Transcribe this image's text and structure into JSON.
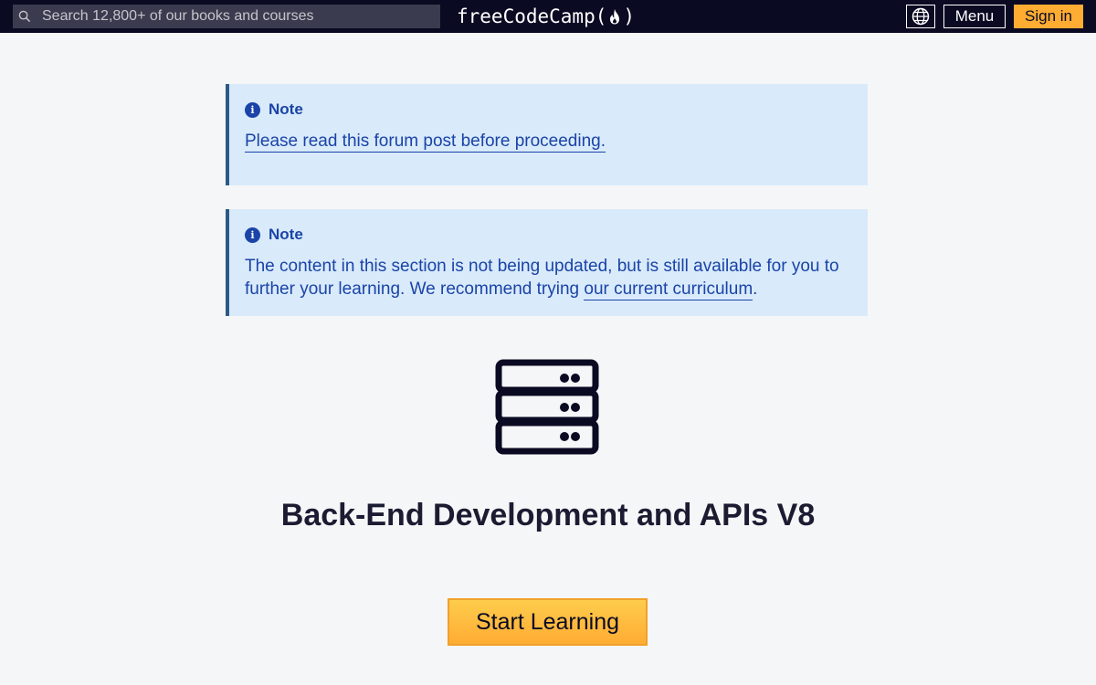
{
  "navbar": {
    "search_placeholder": "Search 12,800+ of our books and courses",
    "logo_text_left": "freeCodeCamp(",
    "logo_text_right": ")",
    "menu_label": "Menu",
    "signin_label": "Sign in",
    "icons": {
      "search": "search-icon",
      "language": "globe-icon",
      "logo_flame": "flame-icon"
    }
  },
  "notes": [
    {
      "heading": "Note",
      "link_text": "Please read this forum post before proceeding."
    },
    {
      "heading": "Note",
      "text_before": "The content in this section is not being updated, but is still available for you to further your learning. We recommend trying ",
      "link_text": "our current curriculum",
      "text_after": "."
    }
  ],
  "main": {
    "icon": "server-icon",
    "title": "Back-End Development and APIs V8",
    "start_label": "Start Learning"
  },
  "colors": {
    "navbar_bg": "#0a0a23",
    "note_bg": "#d9eafa",
    "note_text": "#1a44a8",
    "accent_yellow": "#feac32"
  }
}
